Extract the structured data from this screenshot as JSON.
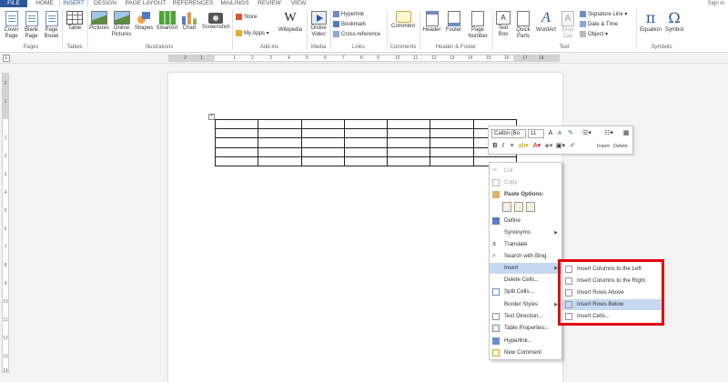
{
  "tabs": {
    "file": "FILE",
    "items": [
      "HOME",
      "INSERT",
      "DESIGN",
      "PAGE LAYOUT",
      "REFERENCES",
      "MAILINGS",
      "REVIEW",
      "VIEW"
    ],
    "active": "INSERT",
    "signin": "Sign in"
  },
  "ribbon": {
    "groups": {
      "pages": "Pages",
      "tables": "Tables",
      "illustrations": "Illustrations",
      "addins": "Add-ins",
      "media": "Media",
      "links": "Links",
      "comments": "Comments",
      "header_footer": "Header & Footer",
      "text": "Text",
      "symbols": "Symbols"
    },
    "buttons": {
      "cover_page": "Cover Page",
      "blank_page": "Blank Page",
      "page_break": "Page Break",
      "table": "Table",
      "pictures": "Pictures",
      "online_pictures": "Online Pictures",
      "shapes": "Shapes",
      "smartart": "SmartArt",
      "chart": "Chart",
      "screenshot": "Screenshot",
      "store": "Store",
      "my_apps": "My Apps",
      "wikipedia": "Wikipedia",
      "online_video": "Online Video",
      "hyperlink": "Hyperlink",
      "bookmark": "Bookmark",
      "cross_reference": "Cross-reference",
      "comment": "Comment",
      "header": "Header",
      "footer": "Footer",
      "page_number": "Page Number",
      "text_box": "Text Box",
      "quick_parts": "Quick Parts",
      "wordart": "WordArt",
      "drop_cap": "Drop Cap",
      "signature_line": "Signature Line",
      "date_time": "Date & Time",
      "object": "Object",
      "equation": "Equation",
      "symbol": "Symbol"
    }
  },
  "ruler": {
    "top_numbers": [
      "2",
      "1",
      "1",
      "2",
      "3",
      "4",
      "5",
      "6",
      "7",
      "8",
      "9",
      "10",
      "11",
      "12",
      "13",
      "14",
      "15",
      "16",
      "17",
      "18"
    ],
    "tab_selector": "L",
    "left_numbers": [
      "2",
      "1",
      "1",
      "2",
      "3",
      "4",
      "5",
      "6",
      "7",
      "8",
      "9",
      "10",
      "11",
      "12",
      "13",
      "14"
    ]
  },
  "mini_toolbar": {
    "font": "Calibri (Bo",
    "size": "11",
    "grow": "A",
    "shrink": "A",
    "bold": "B",
    "italic": "I",
    "align": "≡",
    "insert_label": "Insert",
    "delete_label": "Delete"
  },
  "context_menu": {
    "items": [
      {
        "label": "Cut",
        "disabled": true
      },
      {
        "label": "Copy",
        "disabled": true
      },
      {
        "label": "Paste Options:",
        "header": true
      },
      {
        "label": "Define"
      },
      {
        "label": "Synonyms",
        "submenu": true
      },
      {
        "label": "Translate"
      },
      {
        "label": "Search with Bing"
      },
      {
        "label": "Insert",
        "submenu": true,
        "highlight": true
      },
      {
        "label": "Delete Cells..."
      },
      {
        "label": "Split Cells..."
      },
      {
        "label": "Border Styles",
        "submenu": true
      },
      {
        "label": "Text Direction..."
      },
      {
        "label": "Table Properties..."
      },
      {
        "label": "Hyperlink..."
      },
      {
        "label": "New Comment"
      }
    ]
  },
  "insert_submenu": {
    "items": [
      {
        "label": "Insert Columns to the Left"
      },
      {
        "label": "Insert Columns to the Right"
      },
      {
        "label": "Insert Rows Above"
      },
      {
        "label": "Insert Rows Below",
        "highlight": true
      },
      {
        "label": "Insert Cells..."
      }
    ],
    "highlight_color": "#e3000f"
  }
}
